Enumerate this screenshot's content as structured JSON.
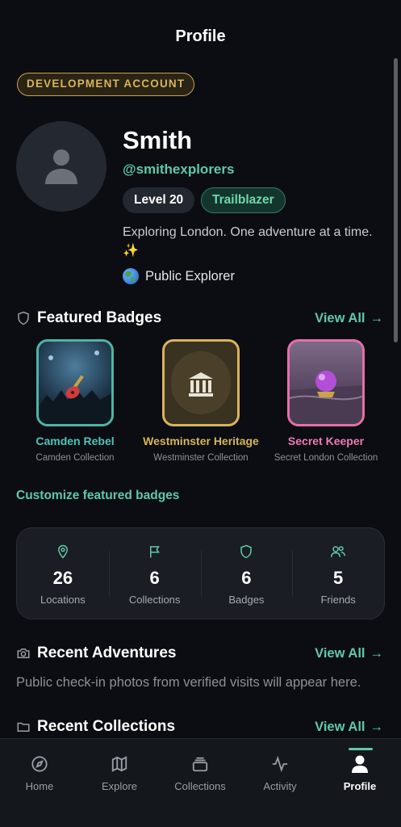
{
  "header": {
    "title": "Profile"
  },
  "account_badge": "DEVELOPMENT ACCOUNT",
  "profile": {
    "name": "Smith",
    "handle": "@smithexplorers",
    "level": "Level 20",
    "title": "Trailblazer",
    "bio": "Exploring London. One adventure at a time. ✨",
    "visibility": "Public Explorer"
  },
  "featured": {
    "heading": "Featured Badges",
    "view_all": "View All",
    "customize": "Customize featured badges",
    "badges": [
      {
        "name": "Camden Rebel",
        "collection": "Camden Collection",
        "color": "#4fb3a6",
        "icon": "guitar-icon"
      },
      {
        "name": "Westminster Heritage",
        "collection": "Westminster Collection",
        "color": "#d9b45a",
        "icon": "classical-building-icon"
      },
      {
        "name": "Secret Keeper",
        "collection": "Secret London Collection",
        "color": "#e56fa8",
        "icon": "crystal-ball-icon"
      }
    ]
  },
  "stats": [
    {
      "icon": "map-pin-icon",
      "value": "26",
      "label": "Locations"
    },
    {
      "icon": "flag-icon",
      "value": "6",
      "label": "Collections"
    },
    {
      "icon": "shield-icon",
      "value": "6",
      "label": "Badges"
    },
    {
      "icon": "users-icon",
      "value": "5",
      "label": "Friends"
    }
  ],
  "adventures": {
    "heading": "Recent Adventures",
    "view_all": "View All",
    "empty_text": "Public check-in photos from verified visits will appear here."
  },
  "collections": {
    "heading": "Recent Collections",
    "view_all": "View All"
  },
  "tabs": [
    {
      "label": "Home",
      "icon": "compass-icon"
    },
    {
      "label": "Explore",
      "icon": "map-icon"
    },
    {
      "label": "Collections",
      "icon": "layers-icon"
    },
    {
      "label": "Activity",
      "icon": "activity-icon"
    },
    {
      "label": "Profile",
      "icon": "user-icon",
      "active": true
    }
  ],
  "colors": {
    "accent": "#5fc9a8",
    "gold": "#d9b45a",
    "pink": "#e56fa8",
    "background": "#0b0d12"
  }
}
